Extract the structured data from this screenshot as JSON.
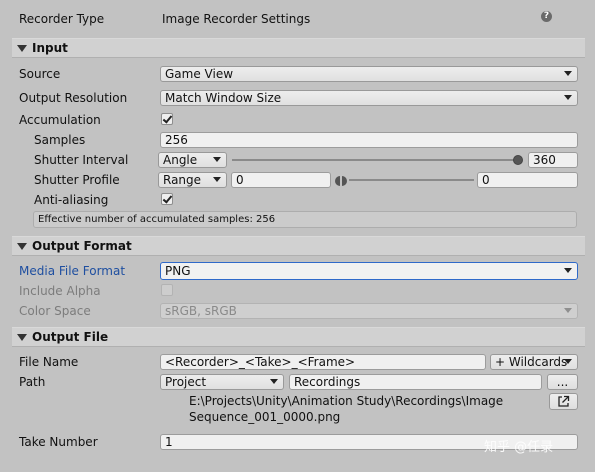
{
  "header": {
    "recorder_type_label": "Recorder Type",
    "recorder_type_value": "Image Recorder Settings",
    "help_icon_glyph": "?"
  },
  "sections": {
    "input": "Input",
    "output_format": "Output Format",
    "output_file": "Output File"
  },
  "input": {
    "source_label": "Source",
    "source_value": "Game View",
    "resolution_label": "Output Resolution",
    "resolution_value": "Match Window Size",
    "accumulation_label": "Accumulation",
    "accumulation_checked": true,
    "samples_label": "Samples",
    "samples_value": "256",
    "shutter_interval_label": "Shutter Interval",
    "shutter_interval_mode": "Angle",
    "shutter_interval_value": "360",
    "shutter_interval_fraction": 1.0,
    "shutter_profile_label": "Shutter Profile",
    "shutter_profile_mode": "Range",
    "shutter_profile_min": "0",
    "shutter_profile_max": "0",
    "antialiasing_label": "Anti-aliasing",
    "antialiasing_checked": true,
    "help_text": "Effective number of accumulated samples: 256"
  },
  "output_format": {
    "media_format_label": "Media File Format",
    "media_format_value": "PNG",
    "include_alpha_label": "Include Alpha",
    "include_alpha_checked": false,
    "color_space_label": "Color Space",
    "color_space_value": "sRGB, sRGB"
  },
  "output_file": {
    "file_name_label": "File Name",
    "file_name_value": "<Recorder>_<Take>_<Frame>",
    "wildcards_label": "+ Wildcards",
    "path_label": "Path",
    "path_root": "Project",
    "path_value": "Recordings",
    "browse_label": "...",
    "full_path_line1": "E:\\Projects\\Unity\\Animation Study\\Recordings\\Image",
    "full_path_line2": "Sequence_001_0000.png",
    "take_number_label": "Take Number",
    "take_number_value": "1"
  },
  "watermark": "知乎 @任录",
  "colors": {
    "background": "#c2c2c2",
    "focus_blue": "#2f69c9",
    "focused_label": "#1f4fa0"
  }
}
